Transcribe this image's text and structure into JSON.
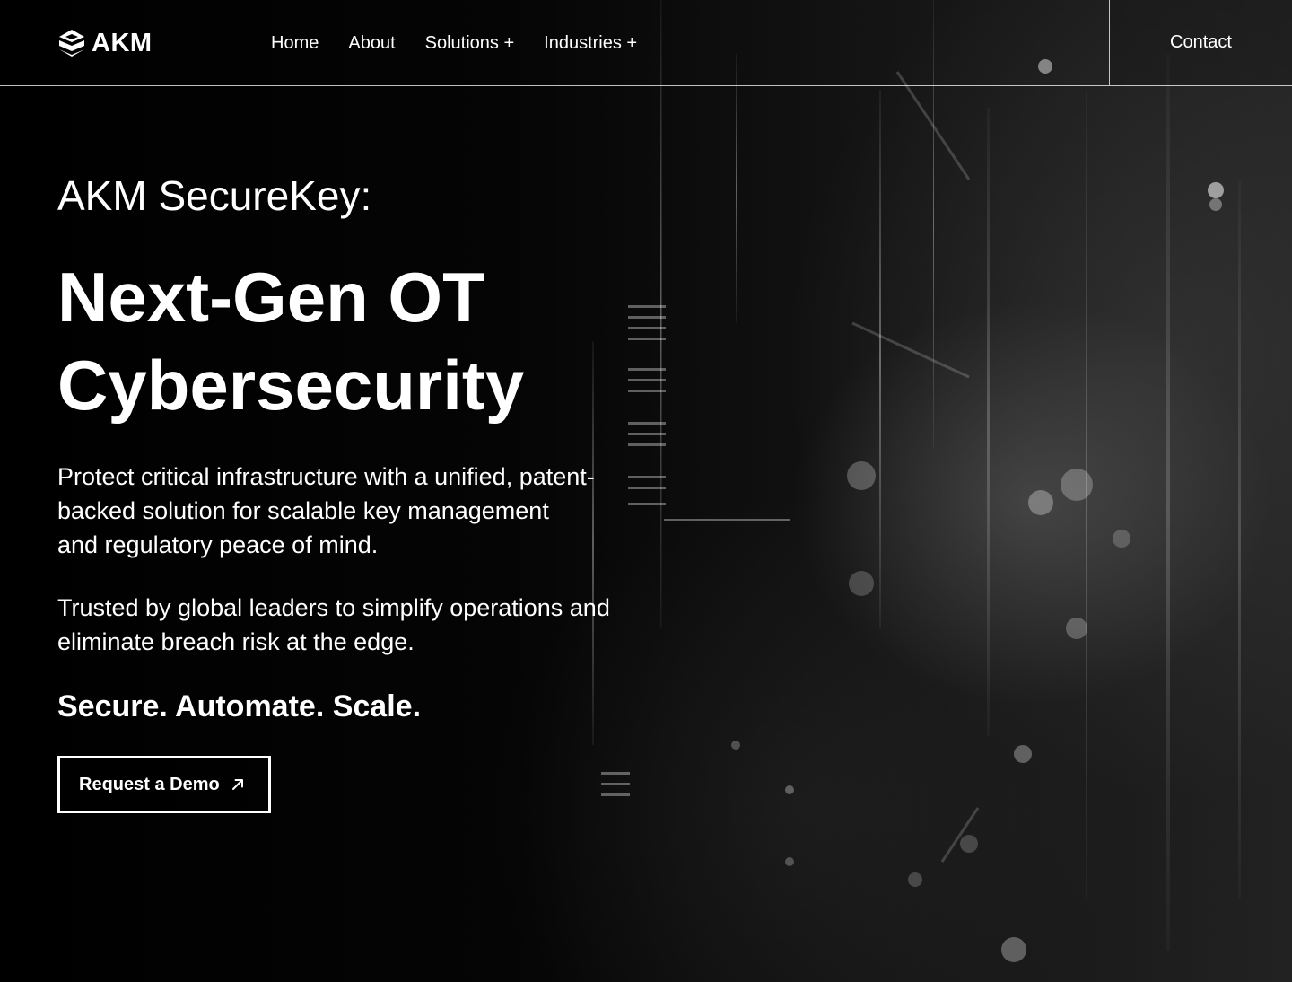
{
  "brand": {
    "logo_text": "AKM"
  },
  "nav": {
    "items": [
      {
        "label": "Home"
      },
      {
        "label": "About"
      },
      {
        "label": "Solutions +"
      },
      {
        "label": "Industries +"
      }
    ],
    "contact_label": "Contact"
  },
  "hero": {
    "eyebrow": "AKM SecureKey:",
    "headline_line1": "Next-Gen OT",
    "headline_line2": "Cybersecurity",
    "paragraph1": "Protect critical infrastructure with a unified, patent-backed solution for scalable key management and regulatory peace of mind.",
    "paragraph2": "Trusted by global leaders to simplify operations and eliminate breach risk at the edge.",
    "tagline": "Secure. Automate. Scale.",
    "cta_label": "Request a Demo",
    "cta_icon": "arrow-up-right-icon"
  },
  "colors": {
    "background": "#000000",
    "text": "#ffffff"
  }
}
